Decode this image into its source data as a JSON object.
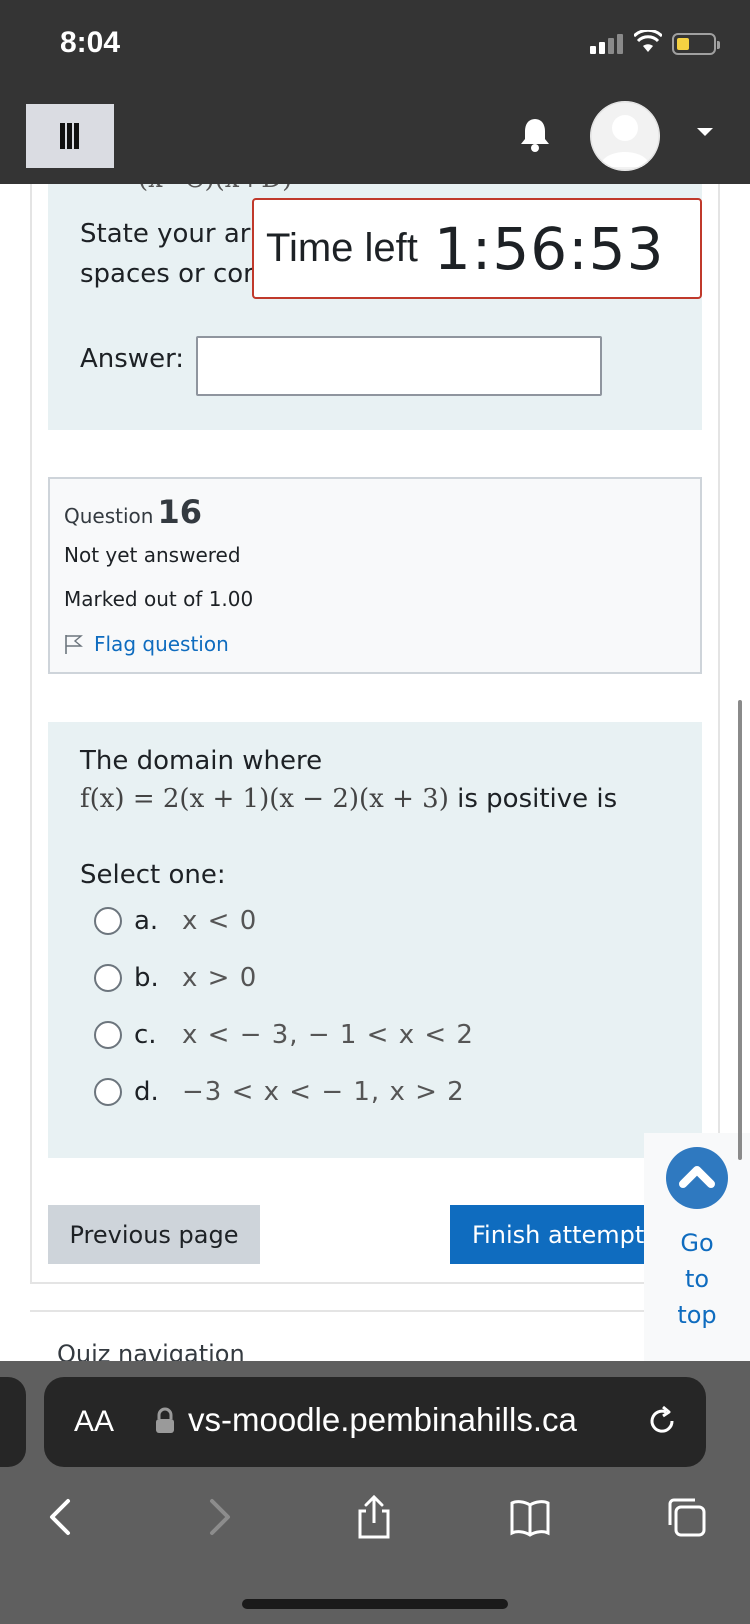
{
  "status_bar": {
    "time": "8:04"
  },
  "header": {
    "menu_icon": "hamburger-icon",
    "notification_icon": "bell-icon",
    "user_menu_icon": "chevron-down-icon"
  },
  "previous_question": {
    "cut_text": "(x−C)(x+D)",
    "instruction": "State your answer without spaces or commas",
    "instruction_line1": "State your ar",
    "instruction_line2": "spaces or cor",
    "answer_label": "Answer:",
    "answer_value": ""
  },
  "timer": {
    "label": "Time left",
    "value": "1:56:53"
  },
  "question_info": {
    "label": "Question",
    "number": "16",
    "status": "Not yet answered",
    "marks": "Marked out of 1.00",
    "flag_label": "Flag question"
  },
  "question": {
    "text_prefix": "The domain where",
    "function": "f(x) = 2(x + 1)(x − 2)(x + 3)",
    "text_suffix": "is positive is",
    "select_label": "Select one:",
    "options": [
      {
        "letter": "a.",
        "text": "x < 0"
      },
      {
        "letter": "b.",
        "text": "x > 0"
      },
      {
        "letter": "c.",
        "text": "x < − 3, − 1 < x < 2"
      },
      {
        "letter": "d.",
        "text": "−3 < x < − 1, x > 2"
      }
    ]
  },
  "navigation": {
    "previous_label": "Previous page",
    "finish_label": "Finish attempt ...",
    "go_to_top": [
      "Go",
      "to",
      "top"
    ],
    "quiz_nav_label": "Quiz navigation"
  },
  "browser": {
    "text_size_label": "AA",
    "url": "vs-moodle.pembinahills.ca"
  },
  "colors": {
    "header_bg": "#343434",
    "question_bg": "#e8f1f3",
    "primary": "#0f6cbf",
    "timer_border": "#c0392b"
  }
}
